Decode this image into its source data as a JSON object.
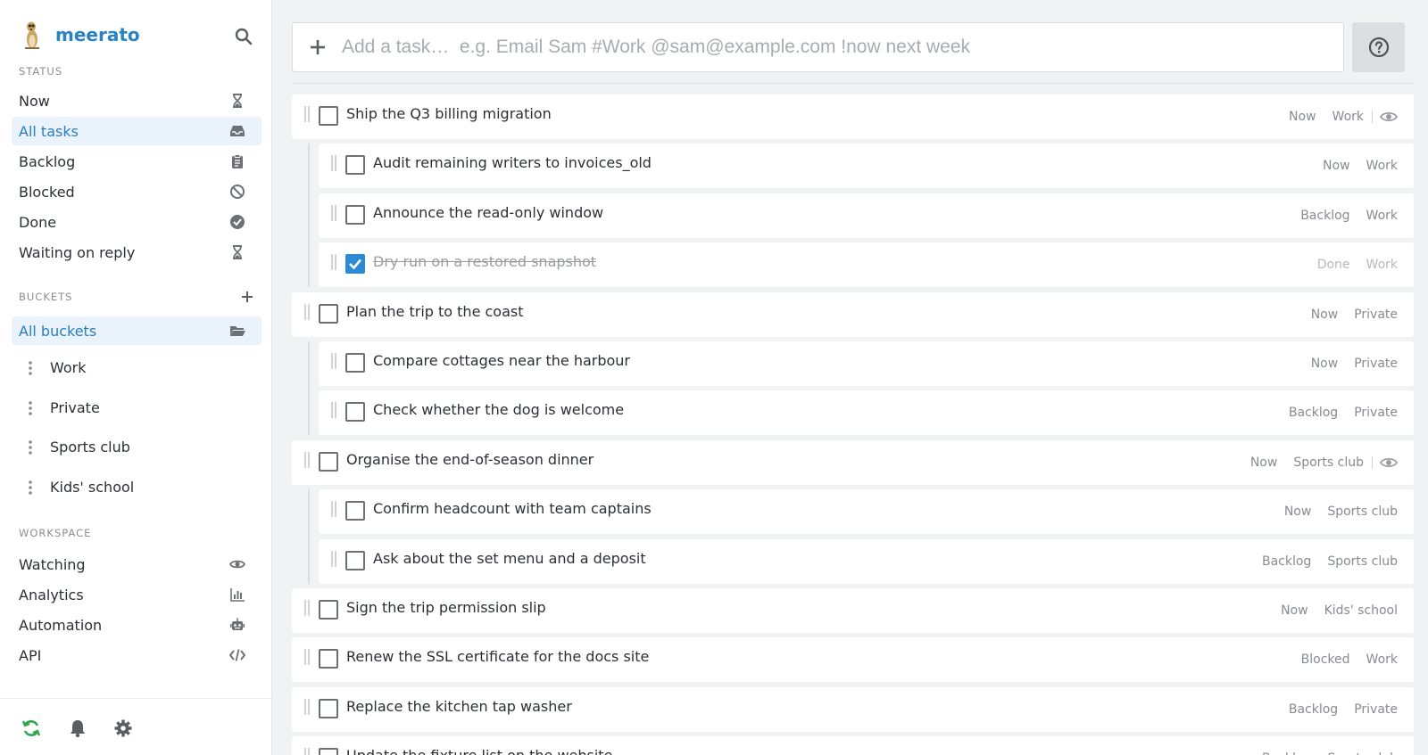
{
  "brand": {
    "name": "meerato"
  },
  "sidebar": {
    "status_title": "STATUS",
    "status_items": [
      {
        "label": "Now",
        "icon": "hourglass-icon"
      },
      {
        "label": "All tasks",
        "icon": "inbox-icon",
        "active": true
      },
      {
        "label": "Backlog",
        "icon": "clipboard-icon"
      },
      {
        "label": "Blocked",
        "icon": "ban-icon"
      },
      {
        "label": "Done",
        "icon": "check-circle-icon"
      },
      {
        "label": "Waiting on reply",
        "icon": "hourglass-icon"
      }
    ],
    "buckets_title": "BUCKETS",
    "all_buckets": "All buckets",
    "buckets": [
      "Work",
      "Private",
      "Sports club",
      "Kids' school"
    ],
    "workspace_title": "WORKSPACE",
    "workspace_items": [
      {
        "label": "Watching",
        "icon": "eye-icon"
      },
      {
        "label": "Analytics",
        "icon": "bar-chart-icon"
      },
      {
        "label": "Automation",
        "icon": "robot-icon"
      },
      {
        "label": "API",
        "icon": "code-icon"
      }
    ]
  },
  "add_task": {
    "placeholder": "Add a task…  e.g. Email Sam #Work @sam@example.com !now next week"
  },
  "tasks": [
    {
      "title": "Ship the Q3 billing migration",
      "status": "Now",
      "bucket": "Work",
      "watched": true,
      "done": false,
      "level": 0
    },
    {
      "title": "Audit remaining writers to invoices_old",
      "status": "Now",
      "bucket": "Work",
      "watched": false,
      "done": false,
      "level": 1
    },
    {
      "title": "Announce the read-only window",
      "status": "Backlog",
      "bucket": "Work",
      "watched": false,
      "done": false,
      "level": 1
    },
    {
      "title": "Dry run on a restored snapshot",
      "status": "Done",
      "bucket": "Work",
      "watched": false,
      "done": true,
      "level": 1
    },
    {
      "title": "Plan the trip to the coast",
      "status": "Now",
      "bucket": "Private",
      "watched": false,
      "done": false,
      "level": 0
    },
    {
      "title": "Compare cottages near the harbour",
      "status": "Now",
      "bucket": "Private",
      "watched": false,
      "done": false,
      "level": 1
    },
    {
      "title": "Check whether the dog is welcome",
      "status": "Backlog",
      "bucket": "Private",
      "watched": false,
      "done": false,
      "level": 1
    },
    {
      "title": "Organise the end-of-season dinner",
      "status": "Now",
      "bucket": "Sports club",
      "watched": true,
      "done": false,
      "level": 0
    },
    {
      "title": "Confirm headcount with team captains",
      "status": "Now",
      "bucket": "Sports club",
      "watched": false,
      "done": false,
      "level": 1
    },
    {
      "title": "Ask about the set menu and a deposit",
      "status": "Backlog",
      "bucket": "Sports club",
      "watched": false,
      "done": false,
      "level": 1
    },
    {
      "title": "Sign the trip permission slip",
      "status": "Now",
      "bucket": "Kids' school",
      "watched": false,
      "done": false,
      "level": 0
    },
    {
      "title": "Renew the SSL certificate for the docs site",
      "status": "Blocked",
      "bucket": "Work",
      "watched": false,
      "done": false,
      "level": 0
    },
    {
      "title": "Replace the kitchen tap washer",
      "status": "Backlog",
      "bucket": "Private",
      "watched": false,
      "done": false,
      "level": 0
    },
    {
      "title": "Update the fixture list on the website",
      "status": "Backlog",
      "bucket": "Sports club",
      "watched": false,
      "done": false,
      "level": 0
    }
  ]
}
